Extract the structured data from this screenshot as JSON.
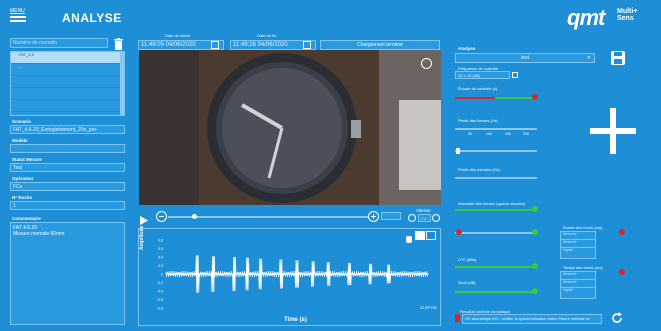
{
  "header": {
    "menu_label": "MENU",
    "title": "ANALYSE",
    "logo_main": "qmt",
    "logo_multi": "Multi+",
    "logo_sens": "Sens"
  },
  "left": {
    "recording_placeholder": "Numéro de recordin",
    "list_items": [
      "FAT_4.6",
      "...",
      "",
      "",
      "",
      ""
    ],
    "scenario_label": "Scenario",
    "scenario_value": "FAT_4.6.20_Enregistrement_20s_pre-",
    "model_label": "Modèle",
    "model_value": "",
    "status_label": "Statut Mesure",
    "status_value": "Test",
    "operator_label": "Opérateur",
    "operator_value": "FCe",
    "bench_label": "N° Roche",
    "bench_value": "1",
    "comments_label": "Commentaire",
    "comments_line1": "FAT 4.6.20",
    "comments_line2": "Mesure normale 60mm"
  },
  "dates": {
    "start_label": "Date de début",
    "start_value": "11:49:05 04/06/2020",
    "end_label": "Date de fin",
    "end_value": "11:49:26 04/06/2020",
    "loading_status": "Chargement terminé"
  },
  "player": {
    "speed_label": "Vitesse",
    "speed_value": "1 x"
  },
  "chart_data": {
    "type": "line",
    "xlabel": "Time (s)",
    "ylabel": "Amplitude",
    "y_ticks": [
      "0.8",
      "0.6",
      "0.4",
      "0.2",
      "0",
      "-0.2",
      "-0.4",
      "-0.6",
      "-0.8"
    ],
    "x_end_label": "22,997708",
    "ylim": [
      -1,
      1
    ],
    "xlim": [
      0,
      22.997708
    ]
  },
  "right": {
    "analysis_label": "Analyse",
    "analysis_value": "test",
    "freq_label": "Fréquence de contrôle",
    "freq_value": "30 ± 15 (dB)",
    "threshold_label": "Écoute de contrôle (s)",
    "fft_label": "Pente des heures (Hz)",
    "fft_ticks": [
      "50",
      "100",
      "150",
      "200"
    ],
    "min_label": "Pente des minutes (Hz)",
    "sync_label": "Intervalle des heures (quarts minutes)",
    "lf_label": "LFC (dBs)",
    "lvl_label": "Seuil (dB)",
    "list_a_label": "Écarte des fronts (ms)",
    "list_a_items": [
      "Mesurée",
      "Mesurée",
      "Digital"
    ],
    "list_b_label": "Temps des fronts (ms)",
    "list_b_items": [
      "Mesurée",
      "Mesurée",
      "Digital"
    ],
    "result_label": "Résultat contrôle acoustique",
    "result_value": "OK acoustique KO : vérifier la synchronisation entre l'heure centrale et"
  }
}
